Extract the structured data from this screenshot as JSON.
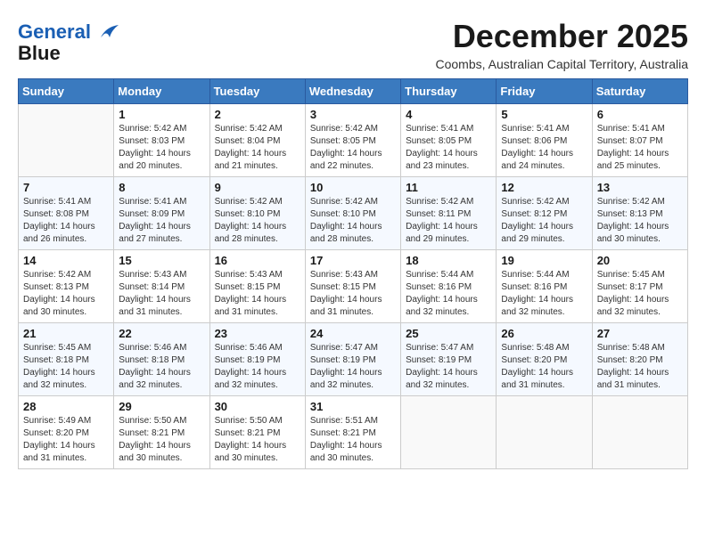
{
  "header": {
    "logo_line1": "General",
    "logo_line2": "Blue",
    "month_title": "December 2025",
    "subtitle": "Coombs, Australian Capital Territory, Australia"
  },
  "calendar": {
    "weekdays": [
      "Sunday",
      "Monday",
      "Tuesday",
      "Wednesday",
      "Thursday",
      "Friday",
      "Saturday"
    ],
    "weeks": [
      [
        {
          "day": "",
          "info": ""
        },
        {
          "day": "1",
          "info": "Sunrise: 5:42 AM\nSunset: 8:03 PM\nDaylight: 14 hours\nand 20 minutes."
        },
        {
          "day": "2",
          "info": "Sunrise: 5:42 AM\nSunset: 8:04 PM\nDaylight: 14 hours\nand 21 minutes."
        },
        {
          "day": "3",
          "info": "Sunrise: 5:42 AM\nSunset: 8:05 PM\nDaylight: 14 hours\nand 22 minutes."
        },
        {
          "day": "4",
          "info": "Sunrise: 5:41 AM\nSunset: 8:05 PM\nDaylight: 14 hours\nand 23 minutes."
        },
        {
          "day": "5",
          "info": "Sunrise: 5:41 AM\nSunset: 8:06 PM\nDaylight: 14 hours\nand 24 minutes."
        },
        {
          "day": "6",
          "info": "Sunrise: 5:41 AM\nSunset: 8:07 PM\nDaylight: 14 hours\nand 25 minutes."
        }
      ],
      [
        {
          "day": "7",
          "info": "Sunrise: 5:41 AM\nSunset: 8:08 PM\nDaylight: 14 hours\nand 26 minutes."
        },
        {
          "day": "8",
          "info": "Sunrise: 5:41 AM\nSunset: 8:09 PM\nDaylight: 14 hours\nand 27 minutes."
        },
        {
          "day": "9",
          "info": "Sunrise: 5:42 AM\nSunset: 8:10 PM\nDaylight: 14 hours\nand 28 minutes."
        },
        {
          "day": "10",
          "info": "Sunrise: 5:42 AM\nSunset: 8:10 PM\nDaylight: 14 hours\nand 28 minutes."
        },
        {
          "day": "11",
          "info": "Sunrise: 5:42 AM\nSunset: 8:11 PM\nDaylight: 14 hours\nand 29 minutes."
        },
        {
          "day": "12",
          "info": "Sunrise: 5:42 AM\nSunset: 8:12 PM\nDaylight: 14 hours\nand 29 minutes."
        },
        {
          "day": "13",
          "info": "Sunrise: 5:42 AM\nSunset: 8:13 PM\nDaylight: 14 hours\nand 30 minutes."
        }
      ],
      [
        {
          "day": "14",
          "info": "Sunrise: 5:42 AM\nSunset: 8:13 PM\nDaylight: 14 hours\nand 30 minutes."
        },
        {
          "day": "15",
          "info": "Sunrise: 5:43 AM\nSunset: 8:14 PM\nDaylight: 14 hours\nand 31 minutes."
        },
        {
          "day": "16",
          "info": "Sunrise: 5:43 AM\nSunset: 8:15 PM\nDaylight: 14 hours\nand 31 minutes."
        },
        {
          "day": "17",
          "info": "Sunrise: 5:43 AM\nSunset: 8:15 PM\nDaylight: 14 hours\nand 31 minutes."
        },
        {
          "day": "18",
          "info": "Sunrise: 5:44 AM\nSunset: 8:16 PM\nDaylight: 14 hours\nand 32 minutes."
        },
        {
          "day": "19",
          "info": "Sunrise: 5:44 AM\nSunset: 8:16 PM\nDaylight: 14 hours\nand 32 minutes."
        },
        {
          "day": "20",
          "info": "Sunrise: 5:45 AM\nSunset: 8:17 PM\nDaylight: 14 hours\nand 32 minutes."
        }
      ],
      [
        {
          "day": "21",
          "info": "Sunrise: 5:45 AM\nSunset: 8:18 PM\nDaylight: 14 hours\nand 32 minutes."
        },
        {
          "day": "22",
          "info": "Sunrise: 5:46 AM\nSunset: 8:18 PM\nDaylight: 14 hours\nand 32 minutes."
        },
        {
          "day": "23",
          "info": "Sunrise: 5:46 AM\nSunset: 8:19 PM\nDaylight: 14 hours\nand 32 minutes."
        },
        {
          "day": "24",
          "info": "Sunrise: 5:47 AM\nSunset: 8:19 PM\nDaylight: 14 hours\nand 32 minutes."
        },
        {
          "day": "25",
          "info": "Sunrise: 5:47 AM\nSunset: 8:19 PM\nDaylight: 14 hours\nand 32 minutes."
        },
        {
          "day": "26",
          "info": "Sunrise: 5:48 AM\nSunset: 8:20 PM\nDaylight: 14 hours\nand 31 minutes."
        },
        {
          "day": "27",
          "info": "Sunrise: 5:48 AM\nSunset: 8:20 PM\nDaylight: 14 hours\nand 31 minutes."
        }
      ],
      [
        {
          "day": "28",
          "info": "Sunrise: 5:49 AM\nSunset: 8:20 PM\nDaylight: 14 hours\nand 31 minutes."
        },
        {
          "day": "29",
          "info": "Sunrise: 5:50 AM\nSunset: 8:21 PM\nDaylight: 14 hours\nand 30 minutes."
        },
        {
          "day": "30",
          "info": "Sunrise: 5:50 AM\nSunset: 8:21 PM\nDaylight: 14 hours\nand 30 minutes."
        },
        {
          "day": "31",
          "info": "Sunrise: 5:51 AM\nSunset: 8:21 PM\nDaylight: 14 hours\nand 30 minutes."
        },
        {
          "day": "",
          "info": ""
        },
        {
          "day": "",
          "info": ""
        },
        {
          "day": "",
          "info": ""
        }
      ]
    ]
  }
}
